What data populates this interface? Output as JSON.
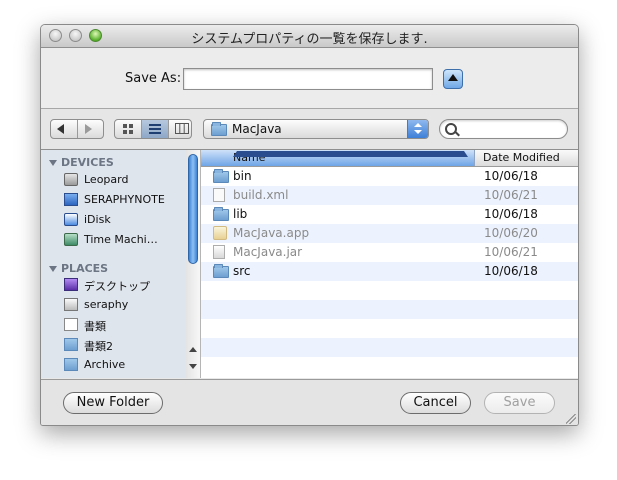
{
  "window": {
    "title": "システムプロパティの一覧を保存します."
  },
  "save": {
    "label": "Save As:",
    "value": ""
  },
  "location": {
    "selected": "MacJava"
  },
  "search": {
    "placeholder": ""
  },
  "sidebar": {
    "devices_header": "DEVICES",
    "places_header": "PLACES",
    "devices": [
      {
        "label": "Leopard",
        "icon": "hard-drive-icon"
      },
      {
        "label": "SERAPHYNOTE",
        "icon": "laptop-icon"
      },
      {
        "label": "iDisk",
        "icon": "idisk-icon"
      },
      {
        "label": "Time Machi…",
        "icon": "time-machine-icon"
      }
    ],
    "places": [
      {
        "label": "デスクトップ",
        "icon": "desktop-icon"
      },
      {
        "label": "seraphy",
        "icon": "home-icon"
      },
      {
        "label": "書類",
        "icon": "documents-icon"
      },
      {
        "label": "書類2",
        "icon": "folder-icon"
      },
      {
        "label": "Archive",
        "icon": "folder-icon"
      }
    ]
  },
  "filelist": {
    "columns": {
      "name": "Name",
      "date": "Date Modified"
    },
    "rows": [
      {
        "name": "bin",
        "date": "10/06/18",
        "kind": "folder",
        "enabled": true
      },
      {
        "name": "build.xml",
        "date": "10/06/21",
        "kind": "document",
        "enabled": false
      },
      {
        "name": "lib",
        "date": "10/06/18",
        "kind": "folder",
        "enabled": true
      },
      {
        "name": "MacJava.app",
        "date": "10/06/20",
        "kind": "application",
        "enabled": false
      },
      {
        "name": "MacJava.jar",
        "date": "10/06/21",
        "kind": "jar",
        "enabled": false
      },
      {
        "name": "src",
        "date": "10/06/18",
        "kind": "folder",
        "enabled": true
      }
    ]
  },
  "buttons": {
    "new_folder": "New Folder",
    "cancel": "Cancel",
    "save": "Save"
  }
}
